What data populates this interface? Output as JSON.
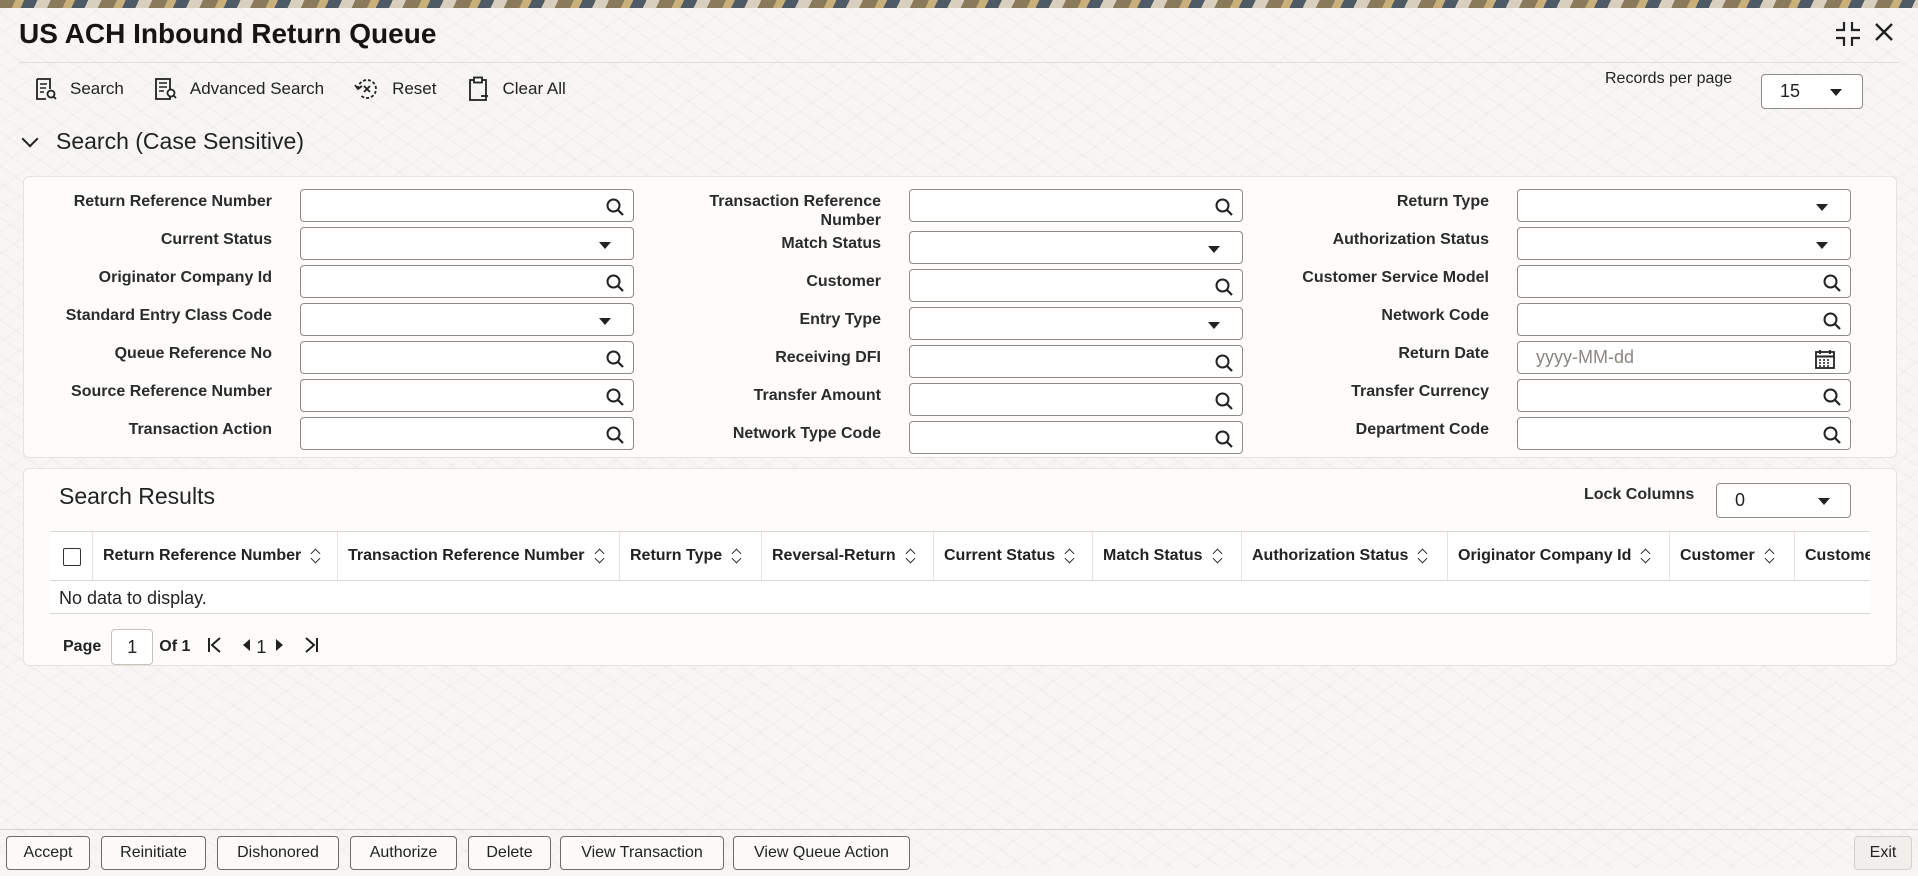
{
  "page": {
    "title": "US ACH Inbound Return Queue"
  },
  "window": {
    "minimize_icon": "collapse-icon",
    "close_icon": "close-icon"
  },
  "toolbar": {
    "search_label": "Search",
    "advanced_search_label": "Advanced Search",
    "reset_label": "Reset",
    "clear_all_label": "Clear All"
  },
  "records_per_page": {
    "label": "Records per page",
    "value": "15"
  },
  "search_section": {
    "title": "Search (Case Sensitive)"
  },
  "fields": {
    "return_reference_number": {
      "label": "Return Reference Number",
      "value": ""
    },
    "transaction_reference_number": {
      "label_line1": "Transaction Reference",
      "label_line2": "Number",
      "value": ""
    },
    "return_type": {
      "label": "Return Type",
      "value": ""
    },
    "current_status": {
      "label": "Current Status",
      "value": ""
    },
    "match_status": {
      "label": "Match Status",
      "value": ""
    },
    "authorization_status": {
      "label": "Authorization Status",
      "value": ""
    },
    "originator_company_id": {
      "label": "Originator Company Id",
      "value": ""
    },
    "customer": {
      "label": "Customer",
      "value": ""
    },
    "customer_service_model": {
      "label": "Customer Service Model",
      "value": ""
    },
    "standard_entry_class_code": {
      "label": "Standard Entry Class Code",
      "value": ""
    },
    "entry_type": {
      "label": "Entry Type",
      "value": ""
    },
    "network_code": {
      "label": "Network Code",
      "value": ""
    },
    "queue_reference_no": {
      "label": "Queue Reference No",
      "value": ""
    },
    "receiving_dfi": {
      "label": "Receiving DFI",
      "value": ""
    },
    "return_date": {
      "label": "Return Date",
      "value": "",
      "placeholder": "yyyy-MM-dd"
    },
    "source_reference_number": {
      "label": "Source Reference Number",
      "value": ""
    },
    "transfer_amount": {
      "label": "Transfer Amount",
      "value": ""
    },
    "transfer_currency": {
      "label": "Transfer Currency",
      "value": ""
    },
    "transaction_action": {
      "label": "Transaction Action",
      "value": ""
    },
    "network_type_code": {
      "label": "Network Type Code",
      "value": ""
    },
    "department_code": {
      "label": "Department Code",
      "value": ""
    }
  },
  "results": {
    "title": "Search Results",
    "lock_columns_label": "Lock Columns",
    "lock_columns_value": "0",
    "columns": [
      "Return Reference Number",
      "Transaction Reference Number",
      "Return Type",
      "Reversal-Return",
      "Current Status",
      "Match Status",
      "Authorization Status",
      "Originator Company Id",
      "Customer",
      "Custome"
    ],
    "empty_message": "No data to display."
  },
  "pager": {
    "page_label": "Page",
    "page_value": "1",
    "of_label": "Of 1",
    "current": "1"
  },
  "footer": {
    "accept": "Accept",
    "reinitiate": "Reinitiate",
    "dishonored": "Dishonored",
    "authorize": "Authorize",
    "delete": "Delete",
    "view_transaction": "View Transaction",
    "view_queue_action": "View Queue Action",
    "exit": "Exit"
  }
}
